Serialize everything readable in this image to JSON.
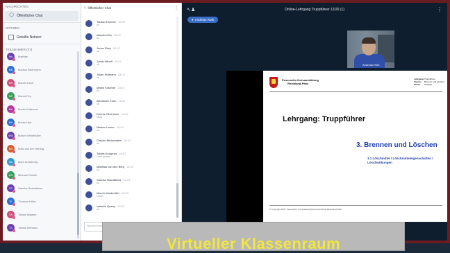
{
  "sidebar": {
    "messages_header": "NACHRICHTEN",
    "public_chat": "Öffentlicher Chat",
    "notes_header": "NOTIZEN",
    "shared_notes": "Geteilte Notizen",
    "participants_header": "TEILNEHMER (37)",
    "users": [
      {
        "initials": "Ma",
        "name": "Mathias",
        "color": "#6a3fb0"
      },
      {
        "initials": "MB",
        "name": "Markus Boermann",
        "color": "#2f6fd1"
      },
      {
        "initials": "MR",
        "name": "Marcel Koch",
        "color": "#d14f7a"
      },
      {
        "initials": "MF",
        "name": "Marco Fey",
        "color": "#3a9b5c"
      },
      {
        "initials": "MK",
        "name": "Moritz Kaltenner",
        "color": "#b03aa0"
      },
      {
        "initials": "MH",
        "name": "Moritz Hub",
        "color": "#2f6fd1"
      },
      {
        "initials": "MW",
        "name": "Maxim Weidmüller",
        "color": "#6a3fb0"
      },
      {
        "initials": "MH",
        "name": "Maik van der Herring",
        "color": "#d1632f"
      },
      {
        "initials": "MA",
        "name": "Marc Armstrong",
        "color": "#2f9bd1"
      },
      {
        "initials": "MG",
        "name": "Michael Geisler",
        "color": "#3a9b5c"
      },
      {
        "initials": "SS",
        "name": "Sascha Scarlattinus",
        "color": "#6a3fb0"
      },
      {
        "initials": "TK",
        "name": "Thomas Keller",
        "color": "#2f6fd1"
      },
      {
        "initials": "TW",
        "name": "Tobias Wagner",
        "color": "#d14f7a"
      },
      {
        "initials": "TS",
        "name": "Tobias Seimans",
        "color": "#6a3fb0"
      }
    ]
  },
  "chat": {
    "back_label": "Öffentlicher Chat",
    "input_placeholder": "Nachricht an Öffentlicher Chat",
    "messages": [
      {
        "name": "Tobias Römmer",
        "time": "18:02",
        "text": "ok"
      },
      {
        "name": "Mandred Ep",
        "time": "18:02",
        "text": "ok"
      },
      {
        "name": "Jonas Riley",
        "time": "18:02",
        "text": "ok"
      },
      {
        "name": "Jonas Althoff",
        "time": "18:02",
        "text": "ok"
      },
      {
        "name": "Julian Hofmann",
        "time": "18:02",
        "text": "ok"
      },
      {
        "name": "Martin Krahmer",
        "time": "18:02",
        "text": "ok"
      },
      {
        "name": "Alexander Kuhn",
        "time": "18:02",
        "text": "ok"
      },
      {
        "name": "Dennis Oberreiner",
        "time": "18:02",
        "text": "Okay"
      },
      {
        "name": "Markus Lerner",
        "time": "18:03",
        "text": "ok"
      },
      {
        "name": "Claudio Blickenstein",
        "time": "18:03",
        "text": "ok"
      },
      {
        "name": "Tobias Kruppner",
        "time": "18:03",
        "text": "Liebe grüsse"
      },
      {
        "name": "Matthias van den Berg",
        "time": "18:03",
        "text": "ok"
      },
      {
        "name": "Sascha Scarlattinus",
        "time": "18:03",
        "text": "ok"
      },
      {
        "name": "Marvin Weidmüller",
        "time": "18:03",
        "text": "Lauch"
      },
      {
        "name": "Isabelle Quarry",
        "time": "18:03",
        "text": "ok"
      }
    ]
  },
  "main": {
    "session_title": "Online-Lehrgang Truppführer 12/20 (1)",
    "presenter": "Andreas Roth",
    "video_caption": "Andreas Roth"
  },
  "slide": {
    "org_line1": "Feuerwehr-Kreisausbildung",
    "org_line2": "Rheinland-Pfalz",
    "meta_lehrgang_k": "Lehrgang:",
    "meta_lehrgang_v": "Truppführer",
    "meta_thema_k": "Thema:",
    "meta_thema_v": "Brennen und Löschen",
    "meta_stand_k": "Stand:",
    "meta_stand_v": "07/2019",
    "title": "Lehrgang: Truppführer",
    "section": "3.  Brennen und Löschen",
    "subsection": "3.1 Löschmittel / Löschmitteleigenschaften / Löschwirkungen",
    "copyright": "© Copyright 2007: Feuerwehr- und Katastrophenschutzschule Rheinland-Pfalz"
  },
  "banner": {
    "text": "Virtueller Klassenraum"
  }
}
